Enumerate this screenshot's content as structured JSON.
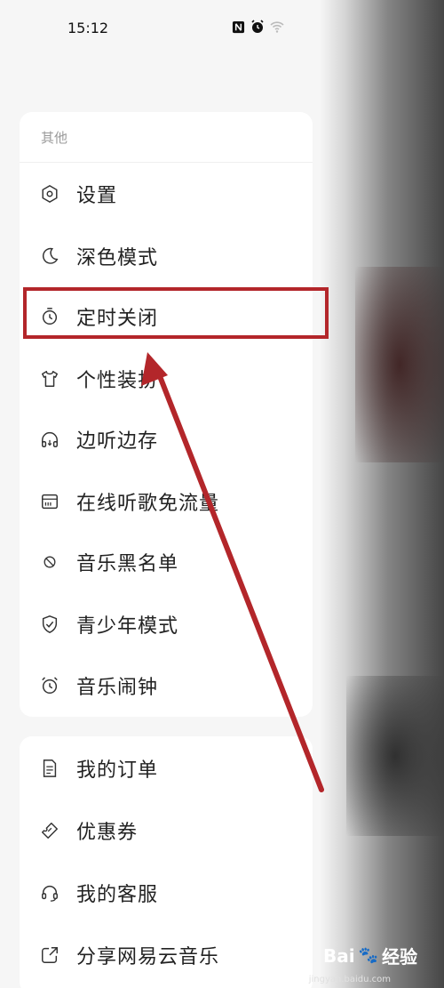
{
  "status": {
    "time": "15:12",
    "icons": [
      "nfc-icon",
      "alarm-icon",
      "wifi-icon"
    ]
  },
  "section1": {
    "title": "其他",
    "items": [
      {
        "label": "设置",
        "icon": "hexagon-settings-icon"
      },
      {
        "label": "深色模式",
        "icon": "moon-icon"
      },
      {
        "label": "定时关闭",
        "icon": "timer-icon"
      },
      {
        "label": "个性装扮",
        "icon": "tshirt-icon"
      },
      {
        "label": "边听边存",
        "icon": "headphones-icon"
      },
      {
        "label": "在线听歌免流量",
        "icon": "sim-card-icon"
      },
      {
        "label": "音乐黑名单",
        "icon": "block-icon"
      },
      {
        "label": "青少年模式",
        "icon": "shield-check-icon"
      },
      {
        "label": "音乐闹钟",
        "icon": "alarm-clock-icon"
      }
    ]
  },
  "section2": {
    "items": [
      {
        "label": "我的订单",
        "icon": "order-document-icon"
      },
      {
        "label": "优惠券",
        "icon": "coupon-icon"
      },
      {
        "label": "我的客服",
        "icon": "headset-icon"
      },
      {
        "label": "分享网易云音乐",
        "icon": "share-icon"
      }
    ]
  },
  "annotation": {
    "highlight_color": "#b3262a",
    "highlighted_item": "定时关闭"
  },
  "watermark": {
    "brand": "Bai",
    "brand_suffix": "经验",
    "url": "jingyan.baidu.com"
  }
}
